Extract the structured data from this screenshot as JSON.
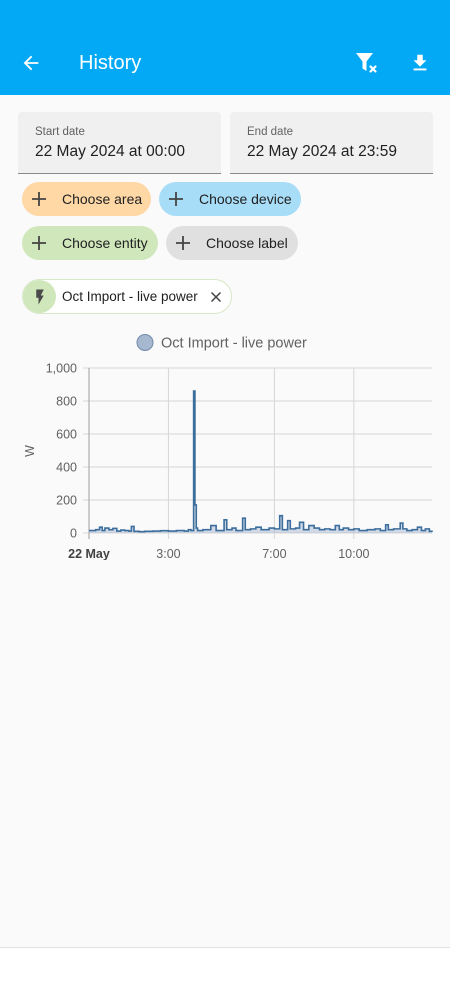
{
  "header": {
    "title": "History",
    "back_icon": "arrow-left-icon",
    "filter_icon": "filter-remove-icon",
    "download_icon": "download-icon",
    "background": "#03a9f4"
  },
  "date_range": {
    "start_label": "Start date",
    "start_value": "22 May 2024 at 00:00",
    "end_label": "End date",
    "end_value": "22 May 2024 at 23:59"
  },
  "target_chips": [
    {
      "label": "Choose area",
      "color": "#ffd8a6"
    },
    {
      "label": "Choose device",
      "color": "#a8ddf8"
    },
    {
      "label": "Choose entity",
      "color": "#cfe7bb"
    },
    {
      "label": "Choose label",
      "color": "#e0e0e0"
    }
  ],
  "selected_entity": {
    "label": "Oct Import - live power",
    "icon": "flash-icon",
    "remove_icon": "close-icon"
  },
  "chart_data": {
    "type": "line",
    "title": "",
    "series": [
      {
        "name": "Oct Import - live power",
        "color": "#3c6e9d",
        "points": [
          [
            0.0,
            15
          ],
          [
            0.25,
            20
          ],
          [
            0.4,
            35
          ],
          [
            0.5,
            15
          ],
          [
            0.6,
            30
          ],
          [
            0.75,
            20
          ],
          [
            0.9,
            28
          ],
          [
            1.05,
            12
          ],
          [
            1.2,
            18
          ],
          [
            1.35,
            15
          ],
          [
            1.5,
            12
          ],
          [
            1.6,
            40
          ],
          [
            1.7,
            10
          ],
          [
            1.9,
            8
          ],
          [
            2.1,
            10
          ],
          [
            2.4,
            12
          ],
          [
            2.7,
            14
          ],
          [
            3.0,
            12
          ],
          [
            3.3,
            15
          ],
          [
            3.6,
            12
          ],
          [
            3.75,
            20
          ],
          [
            3.85,
            15
          ],
          [
            3.95,
            860
          ],
          [
            4.0,
            170
          ],
          [
            4.05,
            30
          ],
          [
            4.1,
            15
          ],
          [
            4.3,
            20
          ],
          [
            4.6,
            45
          ],
          [
            4.8,
            15
          ],
          [
            5.1,
            80
          ],
          [
            5.2,
            20
          ],
          [
            5.4,
            30
          ],
          [
            5.55,
            15
          ],
          [
            5.8,
            90
          ],
          [
            5.9,
            20
          ],
          [
            6.1,
            25
          ],
          [
            6.3,
            35
          ],
          [
            6.5,
            20
          ],
          [
            6.8,
            30
          ],
          [
            7.0,
            25
          ],
          [
            7.2,
            105
          ],
          [
            7.3,
            20
          ],
          [
            7.5,
            75
          ],
          [
            7.6,
            25
          ],
          [
            7.8,
            30
          ],
          [
            7.95,
            65
          ],
          [
            8.1,
            20
          ],
          [
            8.3,
            45
          ],
          [
            8.5,
            30
          ],
          [
            8.7,
            20
          ],
          [
            8.9,
            25
          ],
          [
            9.1,
            20
          ],
          [
            9.3,
            45
          ],
          [
            9.45,
            20
          ],
          [
            9.6,
            30
          ],
          [
            9.8,
            20
          ],
          [
            10.0,
            25
          ],
          [
            10.2,
            15
          ],
          [
            10.5,
            20
          ],
          [
            10.8,
            25
          ],
          [
            11.0,
            15
          ],
          [
            11.2,
            50
          ],
          [
            11.3,
            20
          ],
          [
            11.5,
            25
          ],
          [
            11.75,
            60
          ],
          [
            11.85,
            25
          ],
          [
            12.0,
            15
          ],
          [
            12.2,
            20
          ],
          [
            12.4,
            35
          ],
          [
            12.55,
            15
          ],
          [
            12.7,
            25
          ],
          [
            12.85,
            10
          ],
          [
            12.95,
            5
          ]
        ]
      }
    ],
    "x_ticks": [
      {
        "value": 0,
        "label": "22 May",
        "bold": true
      },
      {
        "value": 3,
        "label": "3:00",
        "bold": false
      },
      {
        "value": 7,
        "label": "7:00",
        "bold": false
      },
      {
        "value": 10,
        "label": "10:00",
        "bold": false
      }
    ],
    "xlim": [
      0,
      12.95
    ],
    "y_ticks": [
      0,
      200,
      400,
      600,
      800,
      1000
    ],
    "y_tick_labels": [
      "0",
      "200",
      "400",
      "600",
      "800",
      "1,000"
    ],
    "ylim": [
      0,
      1000
    ],
    "ylabel": "W",
    "legend_position": "top-center",
    "grid": true
  }
}
